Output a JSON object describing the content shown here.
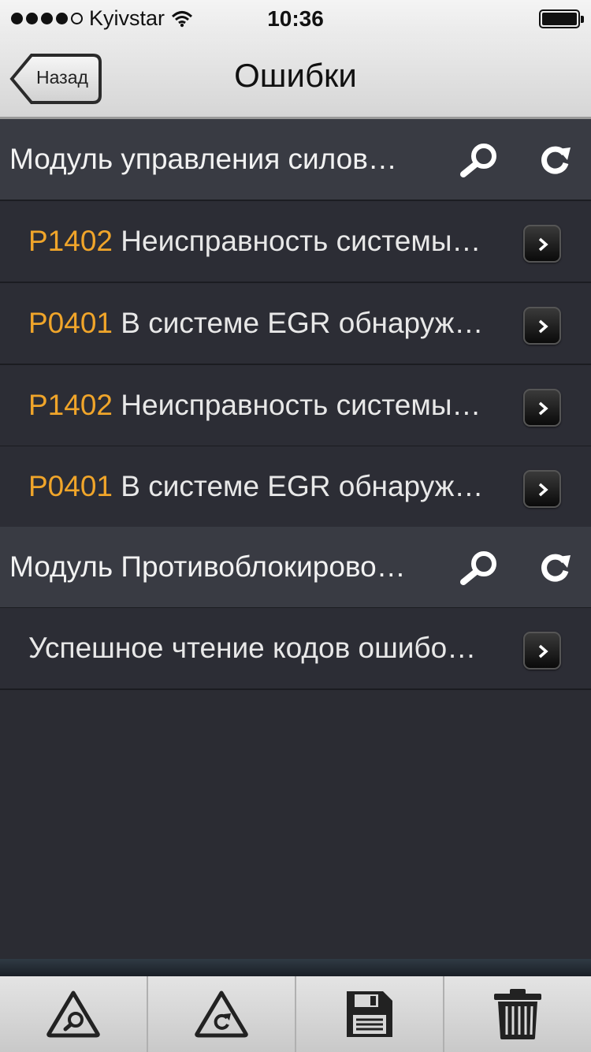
{
  "status_bar": {
    "carrier": "Kyivstar",
    "time": "10:36"
  },
  "nav": {
    "back_label": "Назад",
    "title": "Ошибки"
  },
  "sections": [
    {
      "title": "Модуль управления силов…",
      "rows": [
        {
          "code": "P1402",
          "text": "Неисправность системы…"
        },
        {
          "code": "P0401",
          "text": "В системе EGR обнаруж…"
        },
        {
          "code": "P1402",
          "text": "Неисправность системы…"
        },
        {
          "code": "P0401",
          "text": "В системе EGR обнаруж…"
        }
      ]
    },
    {
      "title": "Модуль Противоблокирово…",
      "rows": [
        {
          "code": "",
          "text": "Успешное чтение кодов ошибо…"
        }
      ]
    }
  ],
  "colors": {
    "code": "#f0a52a",
    "background": "#2b2c33"
  },
  "icons": {
    "toolbar": [
      "scan-triangle-icon",
      "refresh-triangle-icon",
      "save-icon",
      "trash-icon"
    ]
  }
}
